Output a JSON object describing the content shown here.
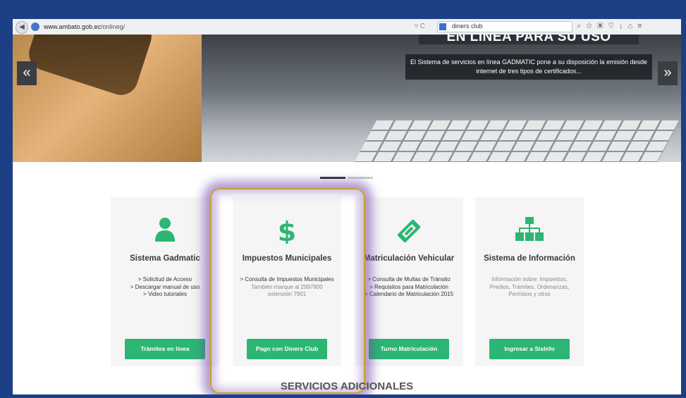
{
  "browser": {
    "url_domain": "www.ambato.gob.ec",
    "url_path": "/onlineg/",
    "search_value": "diners club"
  },
  "hero": {
    "headline": "EN LÍNEA PARA SU USO",
    "caption": "El Sistema de servicios en línea GADMATIC pone a su disposición la emisión desde internet de tres tipos de certificados...",
    "prev_label": "«",
    "next_label": "»"
  },
  "cards": [
    {
      "title": "Sistema Gadmatic",
      "lines": [
        "> Solicitud de Acceso",
        "> Descargar manual de uso",
        "> Video tutoriales"
      ],
      "note": "",
      "button": "Trámites en línea",
      "icon": "user-icon"
    },
    {
      "title": "Impuestos Municipales",
      "lines": [
        "> Consulta de Impuestos Municipales"
      ],
      "note": "También marque al 2997800 extensión 7901",
      "button": "Pago con Diners Club",
      "icon": "dollar-icon"
    },
    {
      "title": "Matriculación Vehicular",
      "lines": [
        "> Consulta de Multas de Tránsito",
        "> Requisitos para Matriculación",
        "> Calendario de Matriculación 2015"
      ],
      "note": "",
      "button": "Turno Matriculación",
      "icon": "ticket-icon"
    },
    {
      "title": "Sistema de Información",
      "lines": [],
      "note": "Información sobre: Impuestos, Predios, Trámites, Ordenanzas, Permisos y otros",
      "button": "Ingresar a SisInfo",
      "icon": "sitemap-icon"
    }
  ],
  "footer": {
    "section_title": "SERVICIOS ADICIONALES"
  },
  "colors": {
    "accent_green": "#2bb673",
    "highlight_purple": "#6e46aa",
    "highlight_gold": "#c9a021",
    "frame_blue": "#1c3f86"
  }
}
